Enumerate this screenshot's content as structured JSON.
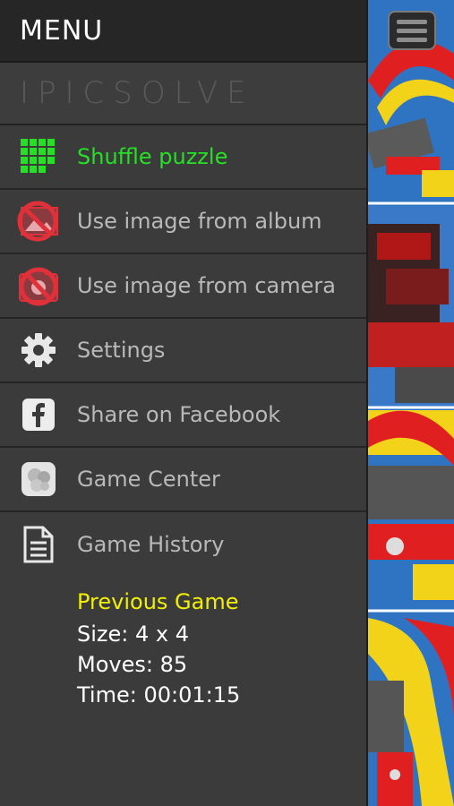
{
  "header": {
    "title": "MENU"
  },
  "brand": {
    "name": "IPICSOLVE"
  },
  "menu": {
    "items": [
      {
        "label": "Shuffle puzzle",
        "icon": "grid-icon"
      },
      {
        "label": "Use image from album",
        "icon": "album-disabled-icon"
      },
      {
        "label": "Use image from camera",
        "icon": "camera-disabled-icon"
      },
      {
        "label": "Settings",
        "icon": "gear-icon"
      },
      {
        "label": "Share on Facebook",
        "icon": "facebook-icon"
      },
      {
        "label": "Game Center",
        "icon": "game-center-icon"
      },
      {
        "label": "Game History",
        "icon": "document-icon"
      }
    ]
  },
  "history": {
    "title": "Previous Game",
    "size": "Size: 4 x 4",
    "moves": "Moves: 85",
    "time": "Time: 00:01:15"
  },
  "colors": {
    "active": "#25e025",
    "highlight": "#f2f000",
    "disabled_red": "#e0303a"
  }
}
